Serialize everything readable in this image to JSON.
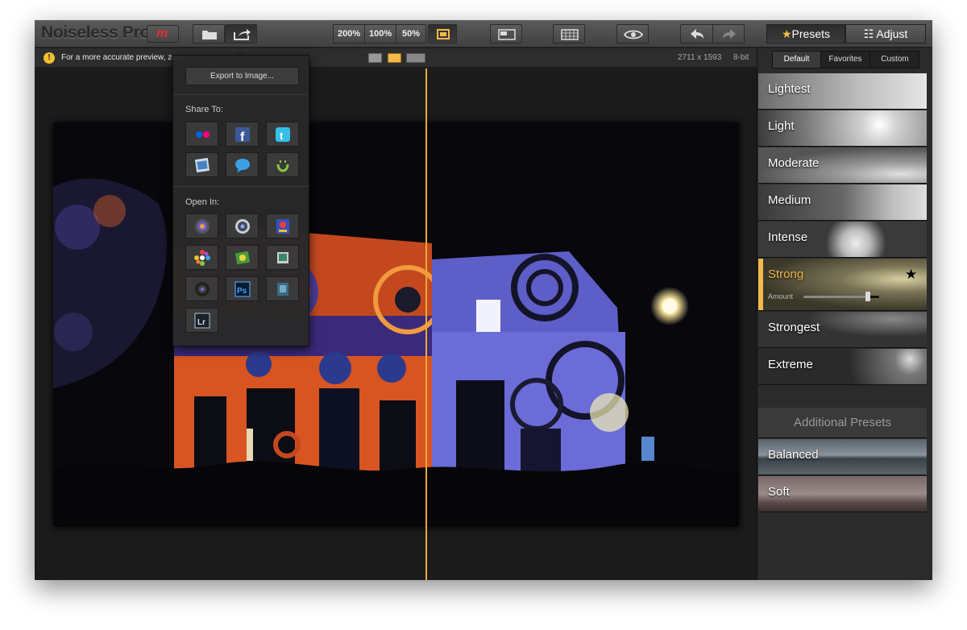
{
  "app": {
    "title": "Noiseless Pro",
    "logo": "m"
  },
  "toolbar": {
    "zoom_options": [
      "200%",
      "100%",
      "50%"
    ],
    "icons": [
      "folder-icon",
      "share-icon",
      "fit-icon",
      "compare-icon",
      "grid-icon",
      "eye-icon",
      "undo-icon",
      "redo-icon"
    ]
  },
  "tabs": {
    "presets": "Presets",
    "adjust": "Adjust"
  },
  "infobar": {
    "warning": "!",
    "message": "For a more accurate preview, zoo",
    "dimensions": "2711 x 1593",
    "bit_depth": "8-bit"
  },
  "export_menu": {
    "export_button": "Export to Image...",
    "share_label": "Share To:",
    "share_items": [
      "flickr",
      "facebook",
      "twitter",
      "photo-browser",
      "messages",
      "smugmug"
    ],
    "open_label": "Open In:",
    "open_items": [
      "aperture",
      "pixelmator",
      "photo-booth",
      "iphoto",
      "photo-editor",
      "preview",
      "camera-app",
      "Ps",
      "image-app",
      "Lr"
    ]
  },
  "preset_tabs": [
    "Default",
    "Favorites",
    "Custom"
  ],
  "presets": [
    {
      "name": "Lightest"
    },
    {
      "name": "Light"
    },
    {
      "name": "Moderate"
    },
    {
      "name": "Medium"
    },
    {
      "name": "Intense"
    },
    {
      "name": "Strong",
      "selected": true,
      "amount_label": "Amount",
      "amount": 0.85
    },
    {
      "name": "Strongest"
    },
    {
      "name": "Extreme"
    }
  ],
  "additional_presets_label": "Additional Presets",
  "additional_presets": [
    {
      "name": "Balanced"
    },
    {
      "name": "Soft"
    }
  ],
  "colors": {
    "accent": "#f3b94a",
    "split_line": "#e8a93a",
    "logo_red": "#e03030"
  }
}
